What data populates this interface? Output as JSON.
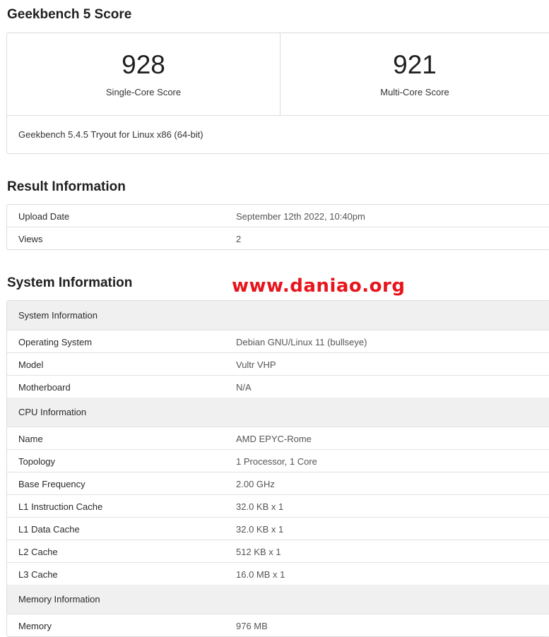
{
  "score": {
    "heading": "Geekbench 5 Score",
    "single_value": "928",
    "single_label": "Single-Core Score",
    "multi_value": "921",
    "multi_label": "Multi-Core Score",
    "version": "Geekbench 5.4.5 Tryout for Linux x86 (64-bit)"
  },
  "result": {
    "heading": "Result Information",
    "rows": [
      {
        "k": "Upload Date",
        "v": "September 12th 2022, 10:40pm"
      },
      {
        "k": "Views",
        "v": "2"
      }
    ]
  },
  "system": {
    "heading": "System Information",
    "sections": {
      "system": {
        "title": "System Information",
        "rows": [
          {
            "k": "Operating System",
            "v": "Debian GNU/Linux 11 (bullseye)"
          },
          {
            "k": "Model",
            "v": "Vultr VHP"
          },
          {
            "k": "Motherboard",
            "v": "N/A"
          }
        ]
      },
      "cpu": {
        "title": "CPU Information",
        "rows": [
          {
            "k": "Name",
            "v": "AMD EPYC-Rome"
          },
          {
            "k": "Topology",
            "v": "1 Processor, 1 Core"
          },
          {
            "k": "Base Frequency",
            "v": "2.00 GHz"
          },
          {
            "k": "L1 Instruction Cache",
            "v": "32.0 KB x 1"
          },
          {
            "k": "L1 Data Cache",
            "v": "32.0 KB x 1"
          },
          {
            "k": "L2 Cache",
            "v": "512 KB x 1"
          },
          {
            "k": "L3 Cache",
            "v": "16.0 MB x 1"
          }
        ]
      },
      "memory": {
        "title": "Memory Information",
        "rows": [
          {
            "k": "Memory",
            "v": "976 MB"
          }
        ]
      }
    }
  },
  "watermark": "www.daniao.org"
}
